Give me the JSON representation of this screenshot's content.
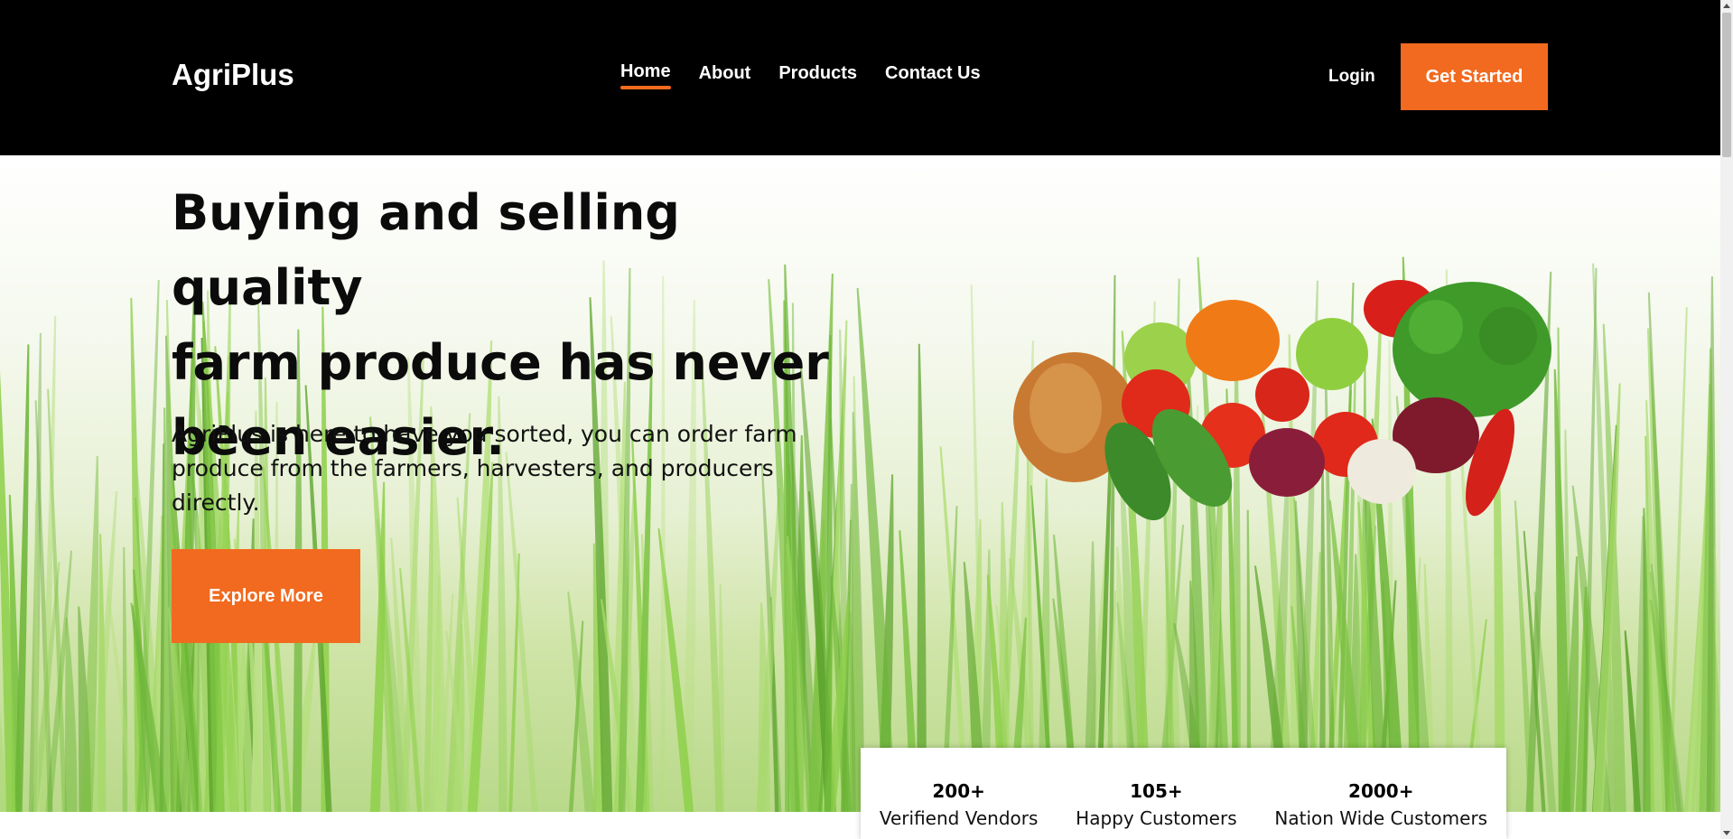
{
  "header": {
    "logo": "AgriPlus",
    "nav": [
      {
        "label": "Home",
        "active": true
      },
      {
        "label": "About",
        "active": false
      },
      {
        "label": "Products",
        "active": false
      },
      {
        "label": "Contact Us",
        "active": false
      }
    ],
    "login_label": "Login",
    "get_started_label": "Get Started"
  },
  "hero": {
    "headline_lines": [
      "Buying and selling quality",
      "farm produce has never",
      "been easier."
    ],
    "subtext": "AgriPlus is here to have you sorted, you can order farm produce from the farmers, harvesters, and producers directly.",
    "explore_label": "Explore More"
  },
  "stats": [
    {
      "value": "200+",
      "label": "Verifiend Vendors"
    },
    {
      "value": "105+",
      "label": "Happy Customers"
    },
    {
      "value": "2000+",
      "label": "Nation Wide Customers"
    }
  ],
  "colors": {
    "accent": "#f26a1f",
    "header_bg": "#000000",
    "grass": "#7cc242"
  }
}
